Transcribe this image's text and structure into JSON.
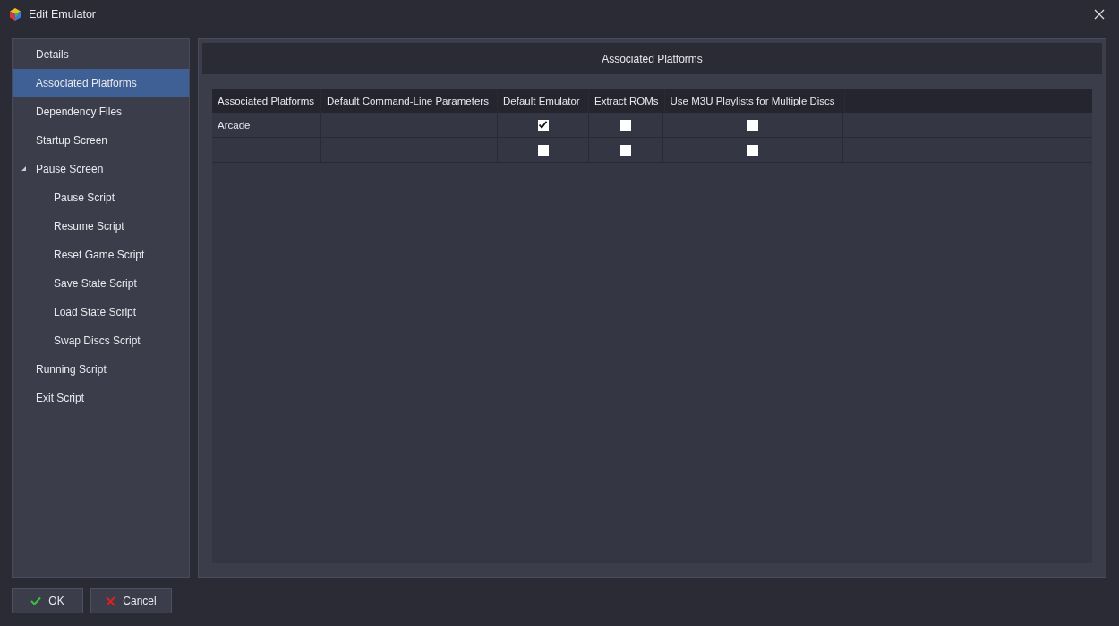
{
  "window": {
    "title": "Edit Emulator"
  },
  "sidebar": {
    "items": [
      {
        "label": "Details",
        "selected": false
      },
      {
        "label": "Associated Platforms",
        "selected": true
      },
      {
        "label": "Dependency Files",
        "selected": false
      },
      {
        "label": "Startup Screen",
        "selected": false
      },
      {
        "label": "Pause Screen",
        "selected": false,
        "expanded": true,
        "children": [
          {
            "label": "Pause Script",
            "selected": false
          },
          {
            "label": "Resume Script",
            "selected": false
          },
          {
            "label": "Reset Game Script",
            "selected": false
          },
          {
            "label": "Save State Script",
            "selected": false
          },
          {
            "label": "Load State Script",
            "selected": false
          },
          {
            "label": "Swap Discs Script",
            "selected": false
          }
        ]
      },
      {
        "label": "Running Script",
        "selected": false
      },
      {
        "label": "Exit Script",
        "selected": false
      }
    ]
  },
  "panel": {
    "title": "Associated Platforms"
  },
  "table": {
    "columns": [
      "Associated Platforms",
      "Default Command-Line Parameters",
      "Default Emulator",
      "Extract ROMs",
      "Use M3U Playlists for Multiple Discs"
    ],
    "rows": [
      {
        "platform": "Arcade",
        "parameters": "",
        "default_emulator": true,
        "extract_roms": false,
        "use_m3u": false
      },
      {
        "platform": "",
        "parameters": "",
        "default_emulator": false,
        "extract_roms": false,
        "use_m3u": false
      }
    ]
  },
  "buttons": [
    {
      "label": "OK",
      "kind": "ok"
    },
    {
      "label": "Cancel",
      "kind": "cancel"
    }
  ]
}
